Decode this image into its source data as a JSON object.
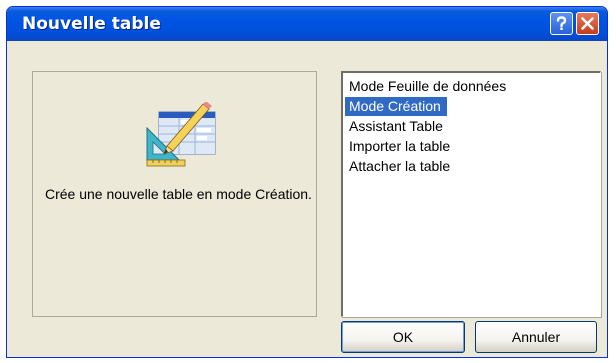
{
  "window": {
    "title": "Nouvelle table"
  },
  "titlebar_buttons": {
    "help_icon": "question-mark",
    "close_icon": "x-cross"
  },
  "left_panel": {
    "illustration_icon": "table-design-icon",
    "description": "Crée une nouvelle table en mode Création."
  },
  "list": {
    "selected_index": 1,
    "items": [
      {
        "label": "Mode Feuille de données"
      },
      {
        "label": "Mode Création"
      },
      {
        "label": "Assistant Table"
      },
      {
        "label": "Importer la table"
      },
      {
        "label": "Attacher la table"
      }
    ]
  },
  "buttons": {
    "ok_label": "OK",
    "cancel_label": "Annuler"
  },
  "colors": {
    "titlebar": "#0054e3",
    "selection": "#316ac5",
    "dialog_bg": "#ece9d8",
    "close_button": "#c53d1c"
  }
}
